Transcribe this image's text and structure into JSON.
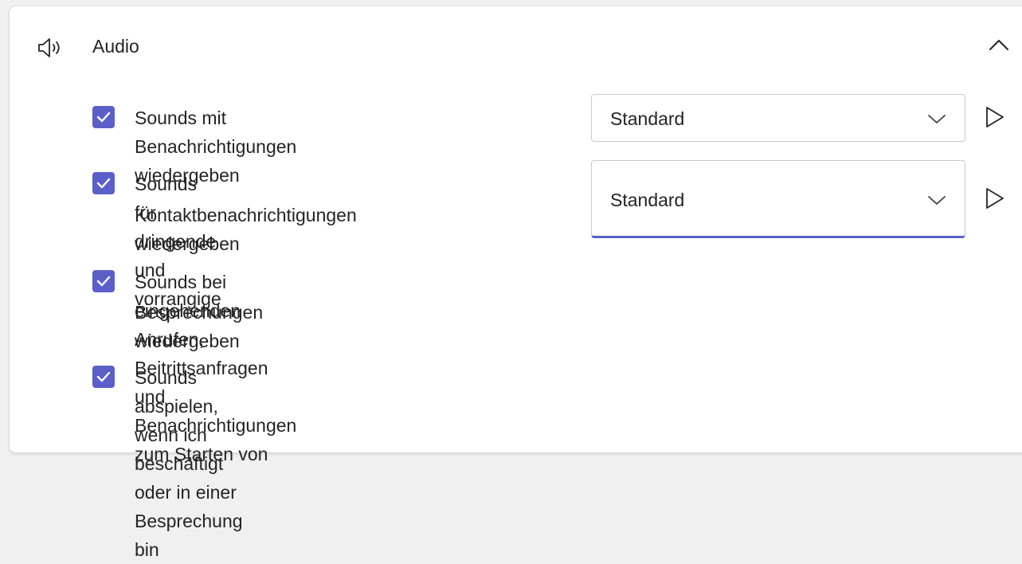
{
  "section": {
    "title": "Audio",
    "icon": "speaker-icon",
    "collapse_icon": "chevron-up-icon"
  },
  "settings": [
    {
      "label_lines": [
        "Sounds mit Benachrichtigungen wiedergeben"
      ],
      "checked": true,
      "dropdown_value": "Standard"
    },
    {
      "label_lines": [
        "Sounds für dringende und vorrangige",
        "Kontaktbenachrichtigungen wiedergeben"
      ],
      "checked": true,
      "dropdown_value": "Standard"
    },
    {
      "label_lines": [
        "Sounds bei eingehenden Anrufen, Beitrittsanfragen und Benachrichtigungen zum Starten von",
        "Besprechungen wiedergeben"
      ],
      "checked": true
    },
    {
      "label_lines": [
        "Sounds abspielen, wenn ich beschäftigt oder in einer Besprechung bin"
      ],
      "checked": true
    }
  ],
  "colors": {
    "accent": "#5b5fc7",
    "text": "#242424",
    "border": "#c9c9c9",
    "background": "#ffffff"
  }
}
